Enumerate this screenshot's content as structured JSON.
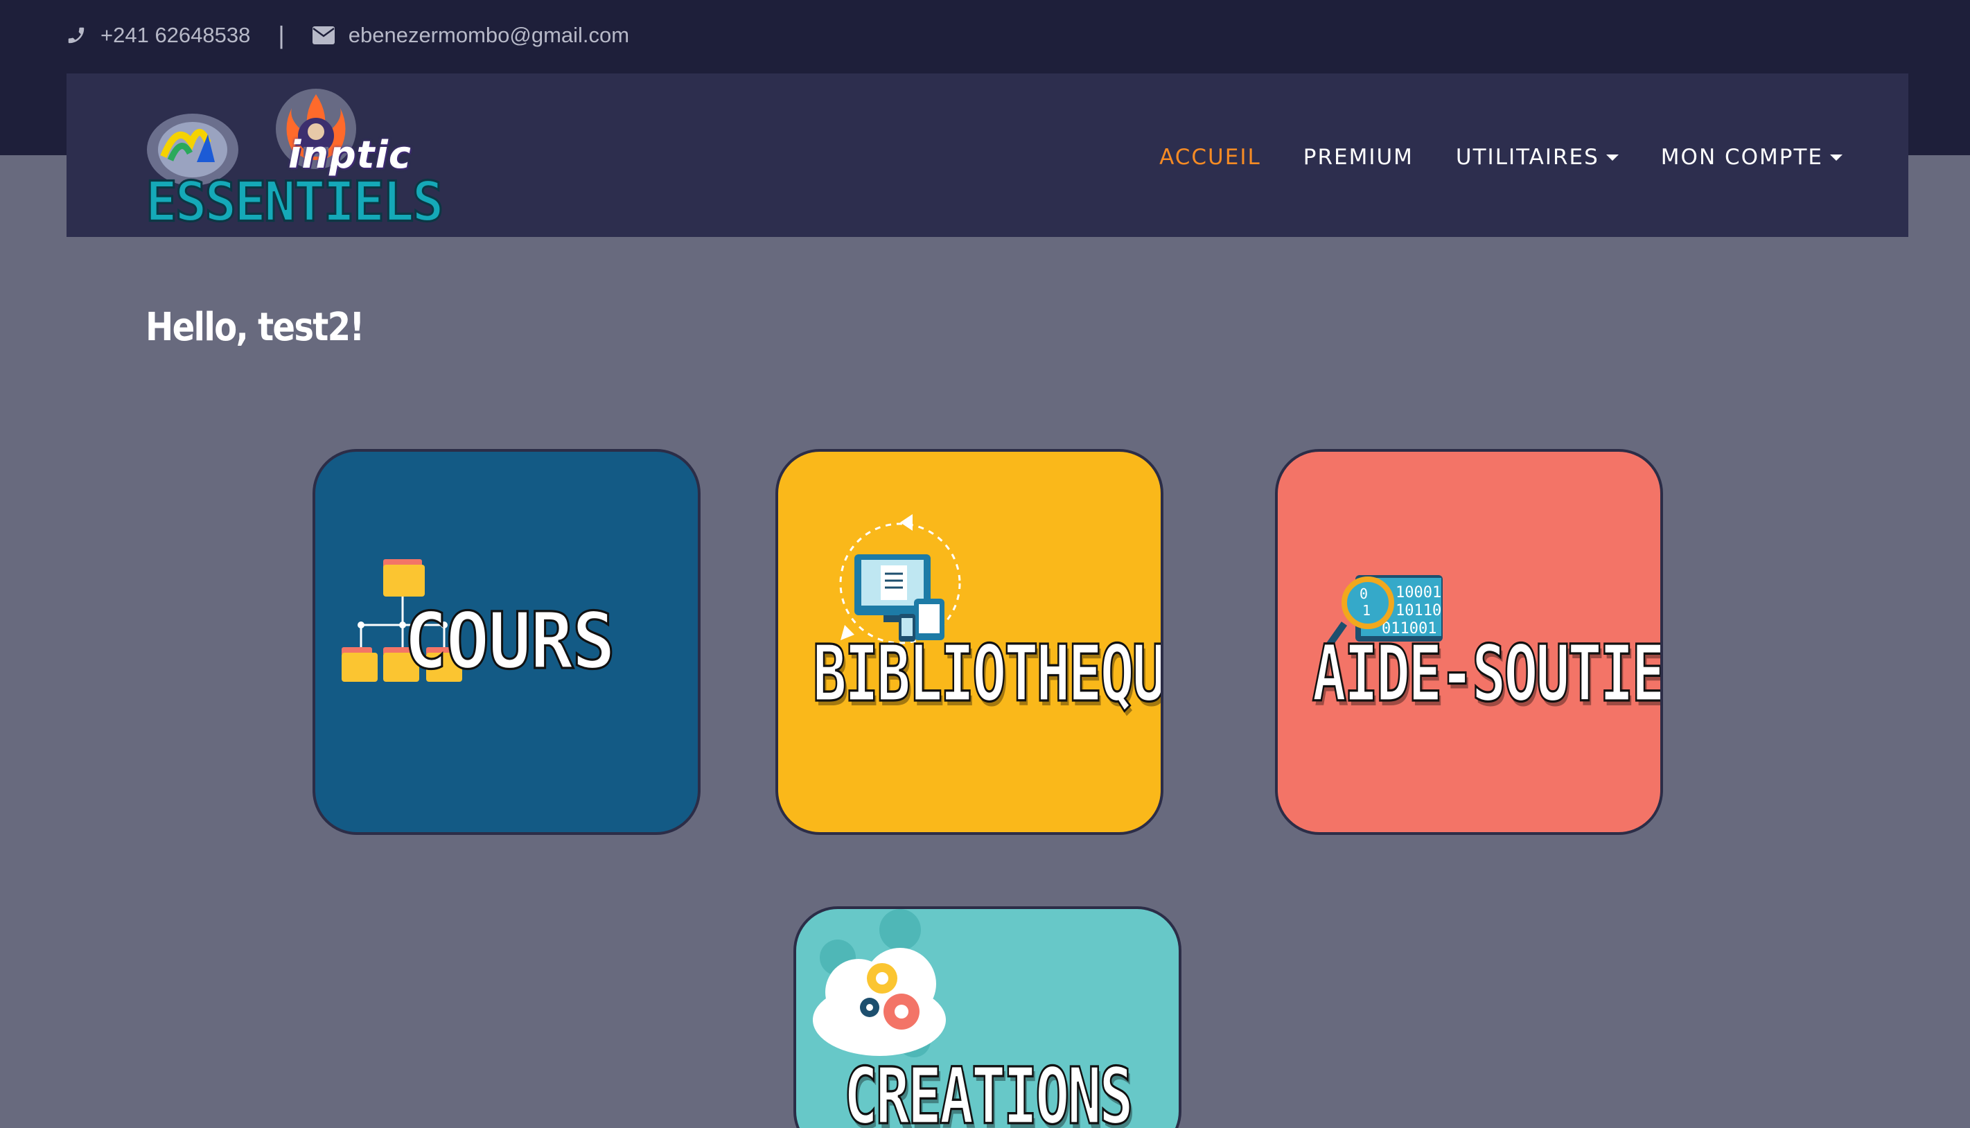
{
  "topbar": {
    "phone": "+241 62648538",
    "separator": "|",
    "email": "ebenezermombo@gmail.com",
    "phone_icon": "phone-icon",
    "email_icon": "envelope-icon"
  },
  "logo": {
    "line1": "inptic",
    "line2": "ESSENTIELS"
  },
  "nav": {
    "items": [
      {
        "label": "ACCUEIL",
        "active": true
      },
      {
        "label": "PREMIUM"
      },
      {
        "label": "UTILITAIRES",
        "dropdown": true
      },
      {
        "label": "MON COMPTE",
        "dropdown": true
      }
    ]
  },
  "greeting": "Hello, test2!",
  "tiles": [
    {
      "label": "COURS",
      "icon": "folder-tree-icon",
      "color": "#135a85"
    },
    {
      "label": "BIBLIOTHEQUE",
      "icon": "library-devices-icon",
      "color": "#fab81a"
    },
    {
      "label": "AIDE-SOUTIEN",
      "icon": "magnifier-binary-icon",
      "color": "#f37467"
    },
    {
      "label": "CREATIONS",
      "icon": "cloud-gears-icon",
      "color": "#67c8c8"
    }
  ],
  "colors": {
    "accent": "#f68b24",
    "page_bg": "#686a7e",
    "navbar_bg": "#2d2e4e",
    "topband_bg": "#1e1f3a"
  }
}
